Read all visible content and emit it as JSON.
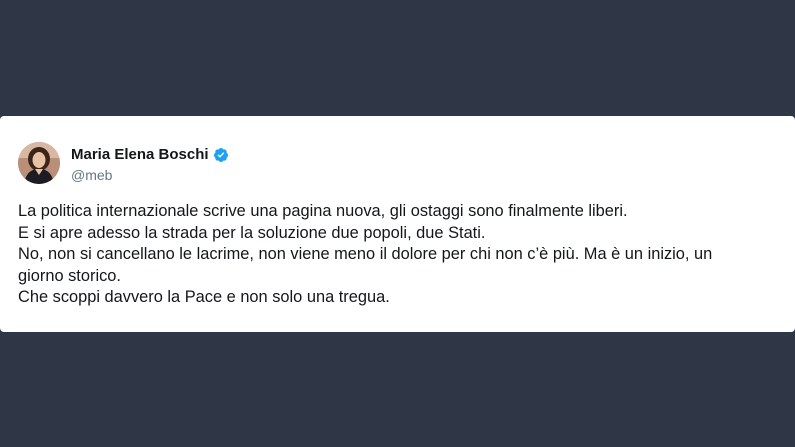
{
  "tweet": {
    "author": {
      "name": "Maria Elena Boschi",
      "handle": "@meb",
      "verified": true,
      "avatar_icon": "profile-photo"
    },
    "lines": [
      "La politica internazionale scrive una pagina nuova, gli ostaggi sono finalmente liberi.",
      "E si apre adesso la strada per la soluzione due popoli, due Stati.",
      "No, non si cancellano le lacrime, non viene meno il dolore per chi non c’è più. Ma è un inizio, un",
      "giorno storico.",
      "Che scoppi davvero la Pace e non solo una tregua."
    ]
  },
  "colors": {
    "background": "#2f3747",
    "card": "#ffffff",
    "verified_badge": "#1da1f2",
    "text": "#14171a",
    "handle": "#657786"
  }
}
